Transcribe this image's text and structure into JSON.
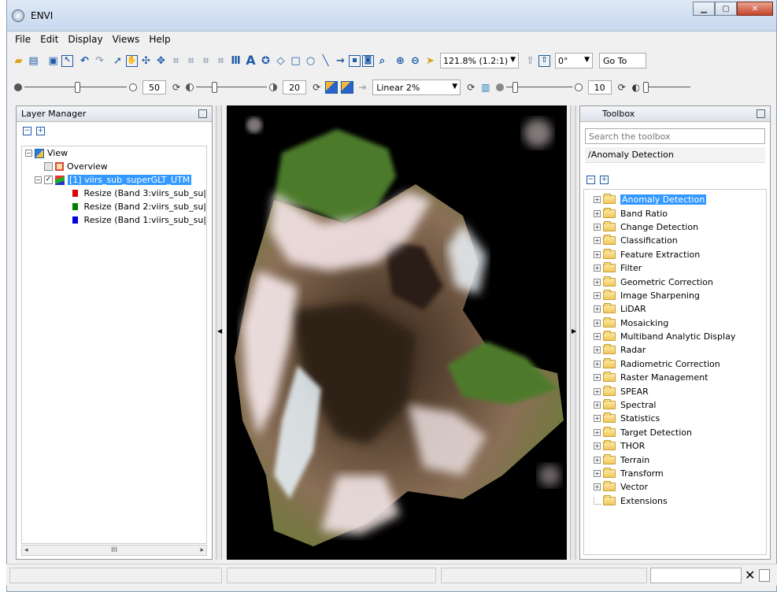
{
  "window": {
    "title": "ENVI"
  },
  "menu": [
    "File",
    "Edit",
    "Display",
    "Views",
    "Help"
  ],
  "toolbar": {
    "zoom_value": "121.8% (1.2:1)",
    "rotation_value": "0°",
    "goto_label": "Go To"
  },
  "display_bar": {
    "brightness_value": "50",
    "contrast_value": "20",
    "stretch_value": "Linear 2%",
    "sharpen_value": "10"
  },
  "layer_manager": {
    "title": "Layer Manager",
    "items": {
      "view": "View",
      "overview": "Overview",
      "raster": "[1] viirs_sub_superGLT_UTM",
      "band3": "Resize (Band 3:viirs_sub_su|",
      "band2": "Resize (Band 2:viirs_sub_su|",
      "band1": "Resize (Band 1:viirs_sub_su|"
    },
    "scroll_grip": "III"
  },
  "toolbox": {
    "title": "Toolbox",
    "search_placeholder": "Search the toolbox",
    "path": "/Anomaly Detection",
    "items": [
      "Anomaly Detection",
      "Band Ratio",
      "Change Detection",
      "Classification",
      "Feature Extraction",
      "Filter",
      "Geometric Correction",
      "Image Sharpening",
      "LiDAR",
      "Mosaicking",
      "Multiband Analytic Display",
      "Radar",
      "Radiometric Correction",
      "Raster Management",
      "SPEAR",
      "Spectral",
      "Statistics",
      "Target Detection",
      "THOR",
      "Terrain",
      "Transform",
      "Vector",
      "Extensions"
    ]
  },
  "colors": {
    "selection": "#3399ff",
    "band_red": "#e00000",
    "band_green": "#008000",
    "band_blue": "#0000e0"
  }
}
